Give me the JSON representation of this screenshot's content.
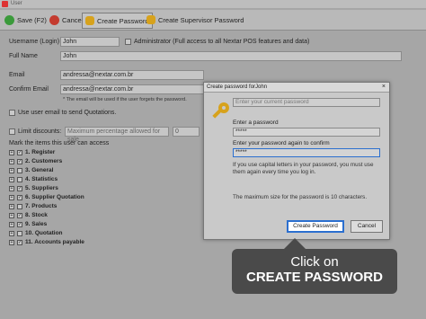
{
  "window": {
    "title": "User"
  },
  "toolbar": {
    "save_label": "Save (F2)",
    "cancel_label": "Cancel",
    "create_password_label": "Create Password",
    "create_supervisor_label": "Create Supervisor Password"
  },
  "form": {
    "username_label": "Username (Login)",
    "username_value": "John",
    "admin_label": "Administrator (Full access to all Nextar POS features and data)",
    "fullname_label": "Full Name",
    "fullname_value": "John",
    "email_label": "Email",
    "email_value": "andressa@nextar.com.br",
    "confirm_email_label": "Confirm Email",
    "confirm_email_value": "andressa@nextar.com.br",
    "email_note": "* The email will be used if the user forgets the password.",
    "use_email_label": "Use user email to send Quotations.",
    "limit_discounts_label": "Limit discounts:",
    "limit_placeholder": "Maximum percentage allowed for sale",
    "limit_value": "0",
    "mark_items_label": "Mark the items this user can access"
  },
  "tree": [
    {
      "label": "1. Register",
      "checked": true
    },
    {
      "label": "2. Customers",
      "checked": true
    },
    {
      "label": "3. General",
      "checked": false
    },
    {
      "label": "4. Statistics",
      "checked": false
    },
    {
      "label": "5. Suppliers",
      "checked": true
    },
    {
      "label": "6. Supplier Quotation",
      "checked": true
    },
    {
      "label": "7. Products",
      "checked": false
    },
    {
      "label": "8. Stock",
      "checked": true
    },
    {
      "label": "9. Sales",
      "checked": true
    },
    {
      "label": "10. Quotation",
      "checked": false
    },
    {
      "label": "11. Accounts payable",
      "checked": true
    }
  ],
  "dialog": {
    "title": "Create password forJohn",
    "current_placeholder": "Enter your current password",
    "enter_label": "Enter a password",
    "enter_value": "*****",
    "confirm_label": "Enter your password again to confirm",
    "confirm_value": "*****",
    "caps_note": "If you use capital letters in your password, you must use them again every time you log in.",
    "max_note": "The maximum size for the password is 10 characters.",
    "create_button": "Create Password",
    "cancel_button": "Cancel"
  },
  "callout": {
    "line1": "Click on",
    "line2": "CREATE PASSWORD"
  }
}
